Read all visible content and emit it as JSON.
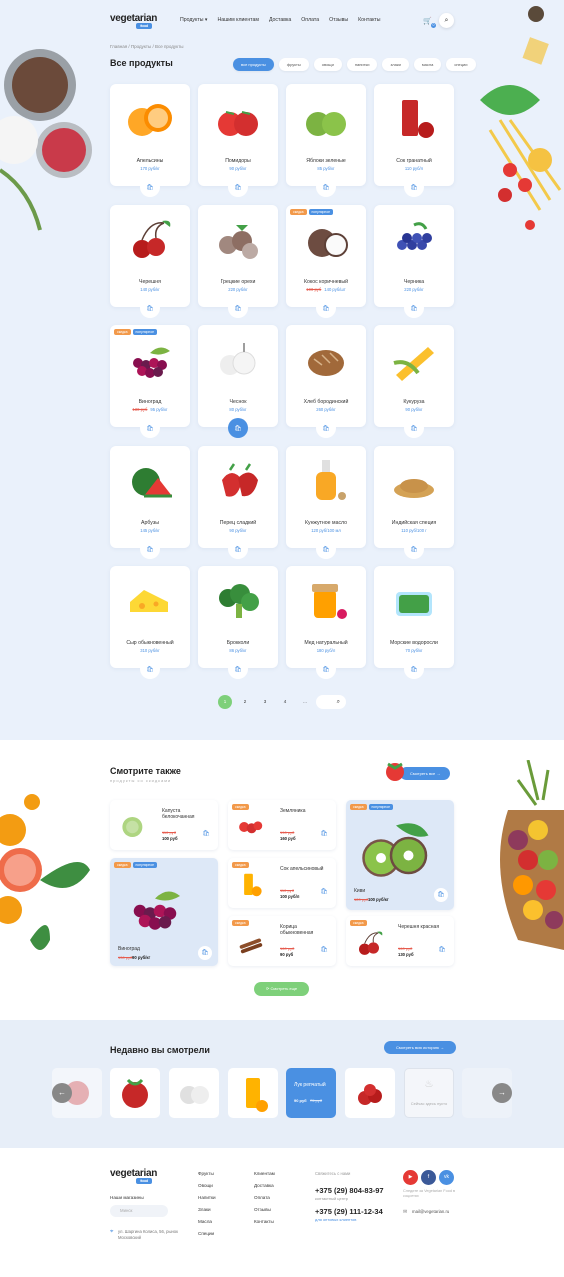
{
  "header": {
    "logo_text": "vegetarian",
    "logo_tag": "food",
    "nav": [
      "Продукты ▾",
      "Нашим клиентам",
      "Доставка",
      "Оплата",
      "Отзывы",
      "Контакты"
    ],
    "cart_count": "0"
  },
  "breadcrumb": "Главная  /  Продукты  /  Все продукты",
  "catalog": {
    "title": "Все продукты",
    "filters": [
      "все продукты",
      "фрукты",
      "овощи",
      "напитки",
      "злаки",
      "масла",
      "специи"
    ],
    "products": [
      {
        "name": "Апельсины",
        "price": "170 руб/кг",
        "old": "",
        "tags": [],
        "icon": "orange"
      },
      {
        "name": "Помидоры",
        "price": "90 руб/кг",
        "old": "",
        "tags": [],
        "icon": "tomato"
      },
      {
        "name": "Яблоки зеленые",
        "price": "85 руб/кг",
        "old": "",
        "tags": [],
        "icon": "apple"
      },
      {
        "name": "Сок гранатный",
        "price": "110 руб/л",
        "old": "",
        "tags": [],
        "icon": "juice"
      },
      {
        "name": "Черешня",
        "price": "140 руб/кг",
        "old": "",
        "tags": [],
        "icon": "cherry"
      },
      {
        "name": "Грецкие орехи",
        "price": "220 руб/кг",
        "old": "",
        "tags": [],
        "icon": "walnut"
      },
      {
        "name": "Кокос коричневый",
        "price": "140 руб/шт",
        "old": "190 руб",
        "tags": [
          "скидка",
          "популярное"
        ],
        "icon": "coconut"
      },
      {
        "name": "Черника",
        "price": "220 руб/кг",
        "old": "",
        "tags": [],
        "icon": "blueberry"
      },
      {
        "name": "Виноград",
        "price": "95 руб/кг",
        "old": "130 руб",
        "tags": [
          "скидка",
          "популярное"
        ],
        "icon": "grape"
      },
      {
        "name": "Чеснок",
        "price": "80 руб/кг",
        "old": "",
        "tags": [],
        "icon": "garlic"
      },
      {
        "name": "Хлеб бородинский",
        "price": "260 руб/кг",
        "old": "",
        "tags": [],
        "icon": "bread"
      },
      {
        "name": "Кукуруза",
        "price": "90 руб/кг",
        "old": "",
        "tags": [],
        "icon": "corn"
      },
      {
        "name": "Арбузы",
        "price": "145 руб/кг",
        "old": "",
        "tags": [],
        "icon": "watermelon"
      },
      {
        "name": "Перец сладкий",
        "price": "90 руб/кг",
        "old": "",
        "tags": [],
        "icon": "pepper"
      },
      {
        "name": "Кунжутное масло",
        "price": "120 руб/100 мл",
        "old": "",
        "tags": [],
        "icon": "oil"
      },
      {
        "name": "Индийская специя",
        "price": "110 руб/100 г",
        "old": "",
        "tags": [],
        "icon": "spice"
      },
      {
        "name": "Сыр обыкновенный",
        "price": "310 руб/кг",
        "old": "",
        "tags": [],
        "icon": "cheese"
      },
      {
        "name": "Брокколи",
        "price": "86 руб/кг",
        "old": "",
        "tags": [],
        "icon": "broccoli"
      },
      {
        "name": "Мед натуральный",
        "price": "180 руб/л",
        "old": "",
        "tags": [],
        "icon": "honey"
      },
      {
        "name": "Морские водоросли",
        "price": "70 руб/кг",
        "old": "",
        "tags": [],
        "icon": "seaweed"
      }
    ],
    "pagination": [
      "1",
      "2",
      "3",
      "4",
      "...",
      "38"
    ]
  },
  "see_also": {
    "title": "Смотрите также",
    "subtitle": "продукты со скидками",
    "all_button": "Смотреть все",
    "items": [
      {
        "name": "Капуста белокочанная",
        "old": "110 руб",
        "price": "100 руб",
        "tags": [],
        "icon": "cabbage"
      },
      {
        "name": "Земляника",
        "old": "190 руб",
        "price": "160 руб",
        "tags": [
          "скидка"
        ],
        "icon": "strawberry"
      },
      {
        "name": "Киви",
        "old": "120 руб",
        "price": "100 руб/кг",
        "tags": [
          "скидка",
          "популярное"
        ],
        "icon": "kiwi"
      },
      {
        "name": "Виноград",
        "old": "130 руб",
        "price": "90 руб/кг",
        "tags": [
          "скидка",
          "популярное"
        ],
        "icon": "grape"
      },
      {
        "name": "Сок апельсиновый",
        "old": "110 руб",
        "price": "100 руб/л",
        "tags": [
          "скидка"
        ],
        "icon": "ojuice"
      },
      {
        "name": "Корица обыкновенная",
        "old": "160 руб",
        "price": "90 руб",
        "tags": [
          "скидка"
        ],
        "icon": "cinnamon"
      },
      {
        "name": "Черешня красная",
        "old": "160 руб",
        "price": "130 руб",
        "tags": [
          "скидка"
        ],
        "icon": "cherry"
      }
    ],
    "more_button": "Смотреть еще"
  },
  "recent": {
    "title": "Недавно вы смотрели",
    "history_button": "Смотреть всю историю",
    "featured_name": "Лук репчатый",
    "featured_price": "90 руб",
    "featured_old": "75 руб",
    "empty_text": "Сейчас здесь пусто"
  },
  "footer": {
    "shops_label": "Наши магазины",
    "city_placeholder": "Минск",
    "address": "ул. Шаргина Колиса, 56, рынок Московский",
    "col1": [
      "Фрукты",
      "Овощи",
      "Напитки",
      "Злаки",
      "Масла",
      "Специи"
    ],
    "col2": [
      "Клиентам",
      "Доставка",
      "Оплата",
      "Отзывы",
      "Контакты"
    ],
    "contact_label": "Свяжитесь с нами",
    "phone1": "+375 (29) 804-83-97",
    "phone1_note": "контактный центр",
    "phone2": "+375 (29) 111-12-34",
    "phone2_note": "для оптовых клиентов",
    "social_note": "Следите за Vegetarian Food в соцсетях",
    "email": "mail@vegetarian.ru"
  },
  "colors": {
    "accent": "#4a90e2",
    "green": "#7ed07a",
    "sale": "#e65c4f",
    "tag_orange": "#f2994a"
  }
}
